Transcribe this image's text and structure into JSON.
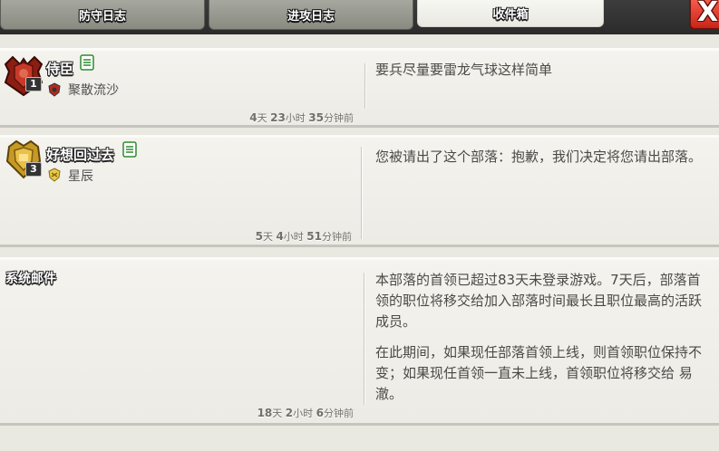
{
  "tabs": [
    {
      "label": "防守日志",
      "active": false
    },
    {
      "label": "进攻日志",
      "active": false
    },
    {
      "label": "收件箱",
      "active": true
    }
  ],
  "close_label": "X",
  "messages": [
    {
      "sender": "侍臣",
      "level": "1",
      "clan": "聚散流沙",
      "body": "要兵尽量要雷龙气球这样简单",
      "time": {
        "d": "4",
        "du": "天",
        "h": "23",
        "hu": "小时",
        "m": "35",
        "mu": "分钟前"
      }
    },
    {
      "sender": "好想回过去",
      "level": "3",
      "clan": "星辰",
      "body": "您被请出了这个部落：抱歉，我们决定将您请出部落。",
      "time": {
        "d": "5",
        "du": "天",
        "h": "4",
        "hu": "小时",
        "m": "51",
        "mu": "分钟前"
      }
    },
    {
      "sender": "系统邮件",
      "body1": "本部落的首领已超过83天未登录游戏。7天后，部落首领的职位将移交给加入部落时间最长且职位最高的活跃成员。",
      "body2": "在此期间，如果现任部落首领上线，则首领职位保持不变；如果现任首领一直未上线，首领职位将移交给 易澈。",
      "time": {
        "d": "18",
        "du": "天",
        "h": "2",
        "hu": "小时",
        "m": "6",
        "mu": "分钟前"
      }
    }
  ],
  "colors": {
    "accent_red": "#c92418",
    "card_bg": "#f4f3ee",
    "text": "#4a4a46"
  }
}
